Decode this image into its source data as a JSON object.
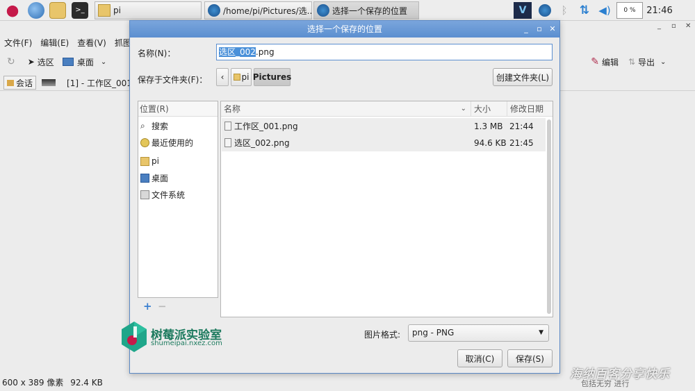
{
  "taskbar": {
    "tasks": [
      {
        "label": "pi"
      },
      {
        "label": "/home/pi/Pictures/选..."
      },
      {
        "label": "选择一个保存的位置"
      }
    ],
    "battery_text": "0 %",
    "clock": "21:46"
  },
  "background_app": {
    "menu": [
      "文件(F)",
      "编辑(E)",
      "查看(V)",
      "抓图("
    ],
    "toolbar": {
      "select": "选区",
      "desktop": "桌面",
      "edit": "编辑",
      "export": "导出"
    },
    "tabs": {
      "session": "会话",
      "image_tab": "[1] - 工作区_001"
    },
    "status": {
      "dimensions": "600 x 389 像素",
      "size": "92.4 KB"
    }
  },
  "dialog": {
    "title": "选择一个保存的位置",
    "name_label": "名称(N)：",
    "name_value_selected": "选区_002",
    "name_value_ext": ".png",
    "save_in_label": "保存于文件夹(F)：",
    "crumbs": [
      "pi",
      "Pictures"
    ],
    "create_folder": "创建文件夹(L)",
    "places_header": "位置(R)",
    "places": [
      {
        "label": "搜索",
        "icon": "search-icon"
      },
      {
        "label": "最近使用的",
        "icon": "clock-icon"
      },
      {
        "label": "pi",
        "icon": "home-folder-icon"
      },
      {
        "label": "桌面",
        "icon": "desktop-icon"
      },
      {
        "label": "文件系统",
        "icon": "drive-icon"
      }
    ],
    "columns": {
      "name": "名称",
      "size": "大小",
      "modified": "修改日期"
    },
    "files": [
      {
        "name": "工作区_001.png",
        "size": "1.3 MB",
        "modified": "21:44"
      },
      {
        "name": "选区_002.png",
        "size": "94.6 KB",
        "modified": "21:45"
      }
    ],
    "format_label": "图片格式:",
    "format_value": "png - PNG",
    "cancel": "取消(C)",
    "save": "保存(S)"
  },
  "logo": {
    "name": "树莓派实验室",
    "url": "shumeipai.nxez.com"
  },
  "watermark": {
    "line1": "海纳百客分享快乐",
    "line2": "包括无穷 进行"
  }
}
